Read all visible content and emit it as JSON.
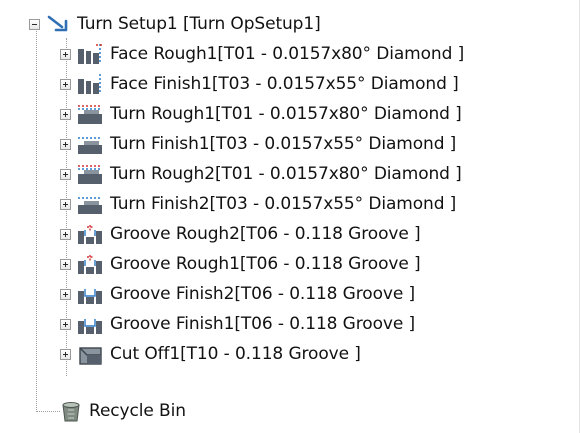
{
  "tree": {
    "root": {
      "label": "Turn Setup1 [Turn OpSetup1]",
      "icon": "turn-setup-icon",
      "expanded": true
    },
    "operations": [
      {
        "label": "Face Rough1[T01 - 0.0157x80° Diamond ]",
        "icon": "face-operation-icon"
      },
      {
        "label": "Face Finish1[T03 - 0.0157x55° Diamond ]",
        "icon": "face-operation-icon"
      },
      {
        "label": "Turn Rough1[T01 - 0.0157x80° Diamond ]",
        "icon": "turn-rough-icon"
      },
      {
        "label": "Turn Finish1[T03 - 0.0157x55° Diamond ]",
        "icon": "turn-finish-icon"
      },
      {
        "label": "Turn Rough2[T01 - 0.0157x80° Diamond ]",
        "icon": "turn-rough-icon"
      },
      {
        "label": "Turn Finish2[T03 - 0.0157x55° Diamond ]",
        "icon": "turn-finish-icon"
      },
      {
        "label": "Groove Rough2[T06 - 0.118 Groove ]",
        "icon": "groove-rough-icon"
      },
      {
        "label": "Groove Rough1[T06 - 0.118 Groove ]",
        "icon": "groove-rough-icon"
      },
      {
        "label": "Groove Finish2[T06 - 0.118 Groove ]",
        "icon": "groove-finish-icon"
      },
      {
        "label": "Groove Finish1[T06 - 0.118 Groove ]",
        "icon": "groove-finish-icon"
      },
      {
        "label": "Cut Off1[T10 - 0.118 Groove ]",
        "icon": "cut-off-icon"
      }
    ],
    "recycle_bin": {
      "label": "Recycle Bin",
      "icon": "recycle-bin-icon"
    }
  }
}
